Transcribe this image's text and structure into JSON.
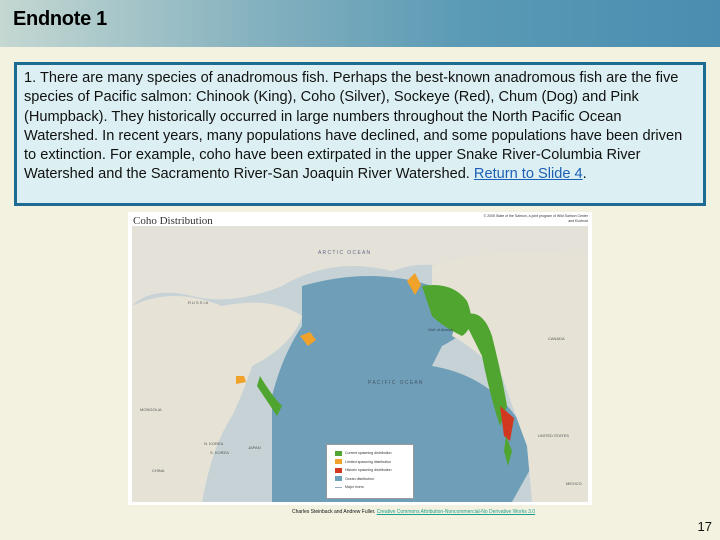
{
  "header": {
    "title": "Endnote 1"
  },
  "note": {
    "text": "1. There are many species of anadromous fish. Perhaps the best-known anadromous fish are the five species of Pacific salmon: Chinook (King), Coho (Silver), Sockeye (Red), Chum (Dog) and Pink (Humpback). They historically occurred in large numbers throughout the North Pacific Ocean Watershed. In recent years, many populations have declined, and some populations have been driven to extinction. For example, coho have been extirpated in the upper Snake River-Columbia River Watershed and the Sacramento River-San Joaquin River Watershed. ",
    "link": "Return to Slide 4",
    "after_link": "."
  },
  "map": {
    "title": "Coho Distribution",
    "credit": "© 2005 State of the Salmon, a joint program of Wild Salmon Center and Ecotrust",
    "labels": {
      "arctic": "A R C T I C   O C E A N",
      "pacific": "P A C I F I C   O C E A N",
      "russia": "R U S S I A",
      "mongolia": "MONGOLIA",
      "china": "CHINA",
      "nkorea": "N. KOREA",
      "skorea": "S. KOREA",
      "japan": "JAPAN",
      "canada": "CANADA",
      "us": "UNITED STATES",
      "mexico": "MEXICO",
      "alaska": "Gulf of Alaska"
    },
    "legend": [
      {
        "label": "Current spawning distribution",
        "color": "#4fa52f"
      },
      {
        "label": "Limited spawning distribution",
        "color": "#f0a22a"
      },
      {
        "label": "Historic spawning distribution",
        "color": "#d2371f"
      },
      {
        "label": "Ocean distribution",
        "color": "#6c9fb9"
      },
      {
        "label": "Major rivers",
        "color": "#c9dbe5"
      }
    ]
  },
  "caption": {
    "authors": "Charles Steinback and Andrew Fuller.",
    "license": "Creative Commons Attribution-Noncommercial-No Derivative Works 3.0"
  },
  "slide_number": "17"
}
